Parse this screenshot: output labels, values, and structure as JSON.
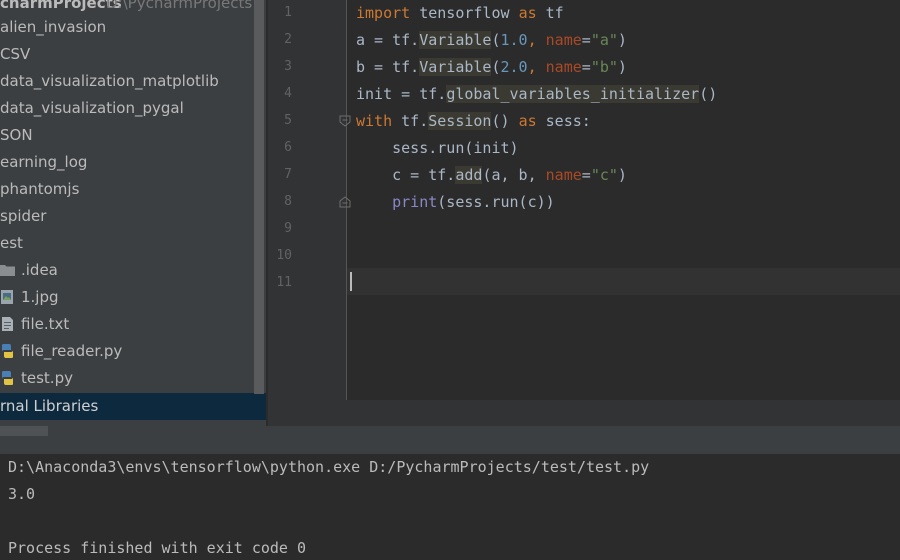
{
  "project_tree": {
    "root_label": "charmProjects",
    "root_path": "D:\\PycharmProjects",
    "items": [
      {
        "label": "alien_invasion",
        "icon": "folder-icon"
      },
      {
        "label": "CSV",
        "icon": "folder-icon"
      },
      {
        "label": "data_visualization_matplotlib",
        "icon": "folder-icon"
      },
      {
        "label": "data_visualization_pygal",
        "icon": "folder-icon"
      },
      {
        "label": "SON",
        "icon": "folder-icon"
      },
      {
        "label": "earning_log",
        "icon": "folder-icon"
      },
      {
        "label": "phantomjs",
        "icon": "folder-icon"
      },
      {
        "label": "spider",
        "icon": "folder-icon"
      },
      {
        "label": "est",
        "icon": "folder-icon"
      },
      {
        "label": ".idea",
        "icon": "folder-icon"
      },
      {
        "label": "1.jpg",
        "icon": "image-file-icon"
      },
      {
        "label": "file.txt",
        "icon": "text-file-icon"
      },
      {
        "label": "file_reader.py",
        "icon": "python-file-icon"
      },
      {
        "label": "test.py",
        "icon": "python-file-icon"
      }
    ],
    "external_libraries": "rnal Libraries"
  },
  "editor": {
    "line_numbers": [
      "1",
      "2",
      "3",
      "4",
      "5",
      "6",
      "7",
      "8",
      "9",
      "10",
      "11"
    ],
    "code": {
      "l1": {
        "kw_import": "import",
        "mod": " tensorflow ",
        "kw_as": "as",
        "alias": " tf"
      },
      "l2": {
        "pre": "a = tf.",
        "fn": "Variable",
        "open": "(",
        "num": "1.0",
        "comma": ", ",
        "param": "name",
        "eq": "=",
        "str": "\"a\"",
        "close": ")"
      },
      "l3": {
        "pre": "b = tf.",
        "fn": "Variable",
        "open": "(",
        "num": "2.0",
        "comma": ", ",
        "param": "name",
        "eq": "=",
        "str": "\"b\"",
        "close": ")"
      },
      "l4": {
        "pre": "init = tf.",
        "fn": "global_variables_initializer",
        "close": "()"
      },
      "l5": {
        "kw_with": "with",
        "mid": " tf.",
        "fn": "Session",
        "call": "() ",
        "kw_as": "as",
        "post": " sess:"
      },
      "l6": {
        "text": "    sess.run(init)"
      },
      "l7": {
        "pre": "    c = tf.",
        "fn": "add",
        "args": "(a, b, ",
        "param": "name",
        "eq": "=",
        "str": "\"c\"",
        "close": ")"
      },
      "l8": {
        "indent": "    ",
        "builtin": "print",
        "rest": "(sess.run(c))"
      }
    }
  },
  "console": {
    "lines": [
      "D:\\Anaconda3\\envs\\tensorflow\\python.exe D:/PycharmProjects/test/test.py",
      "3.0",
      "",
      "Process finished with exit code 0"
    ]
  },
  "colors": {
    "tree_bg": "#3c3f41",
    "editor_bg": "#2b2b2b",
    "keyword": "#cc7832",
    "number": "#6897bb",
    "string": "#6a8759",
    "param": "#aa4926",
    "builtin": "#8888c6",
    "selection": "#0d293e"
  }
}
